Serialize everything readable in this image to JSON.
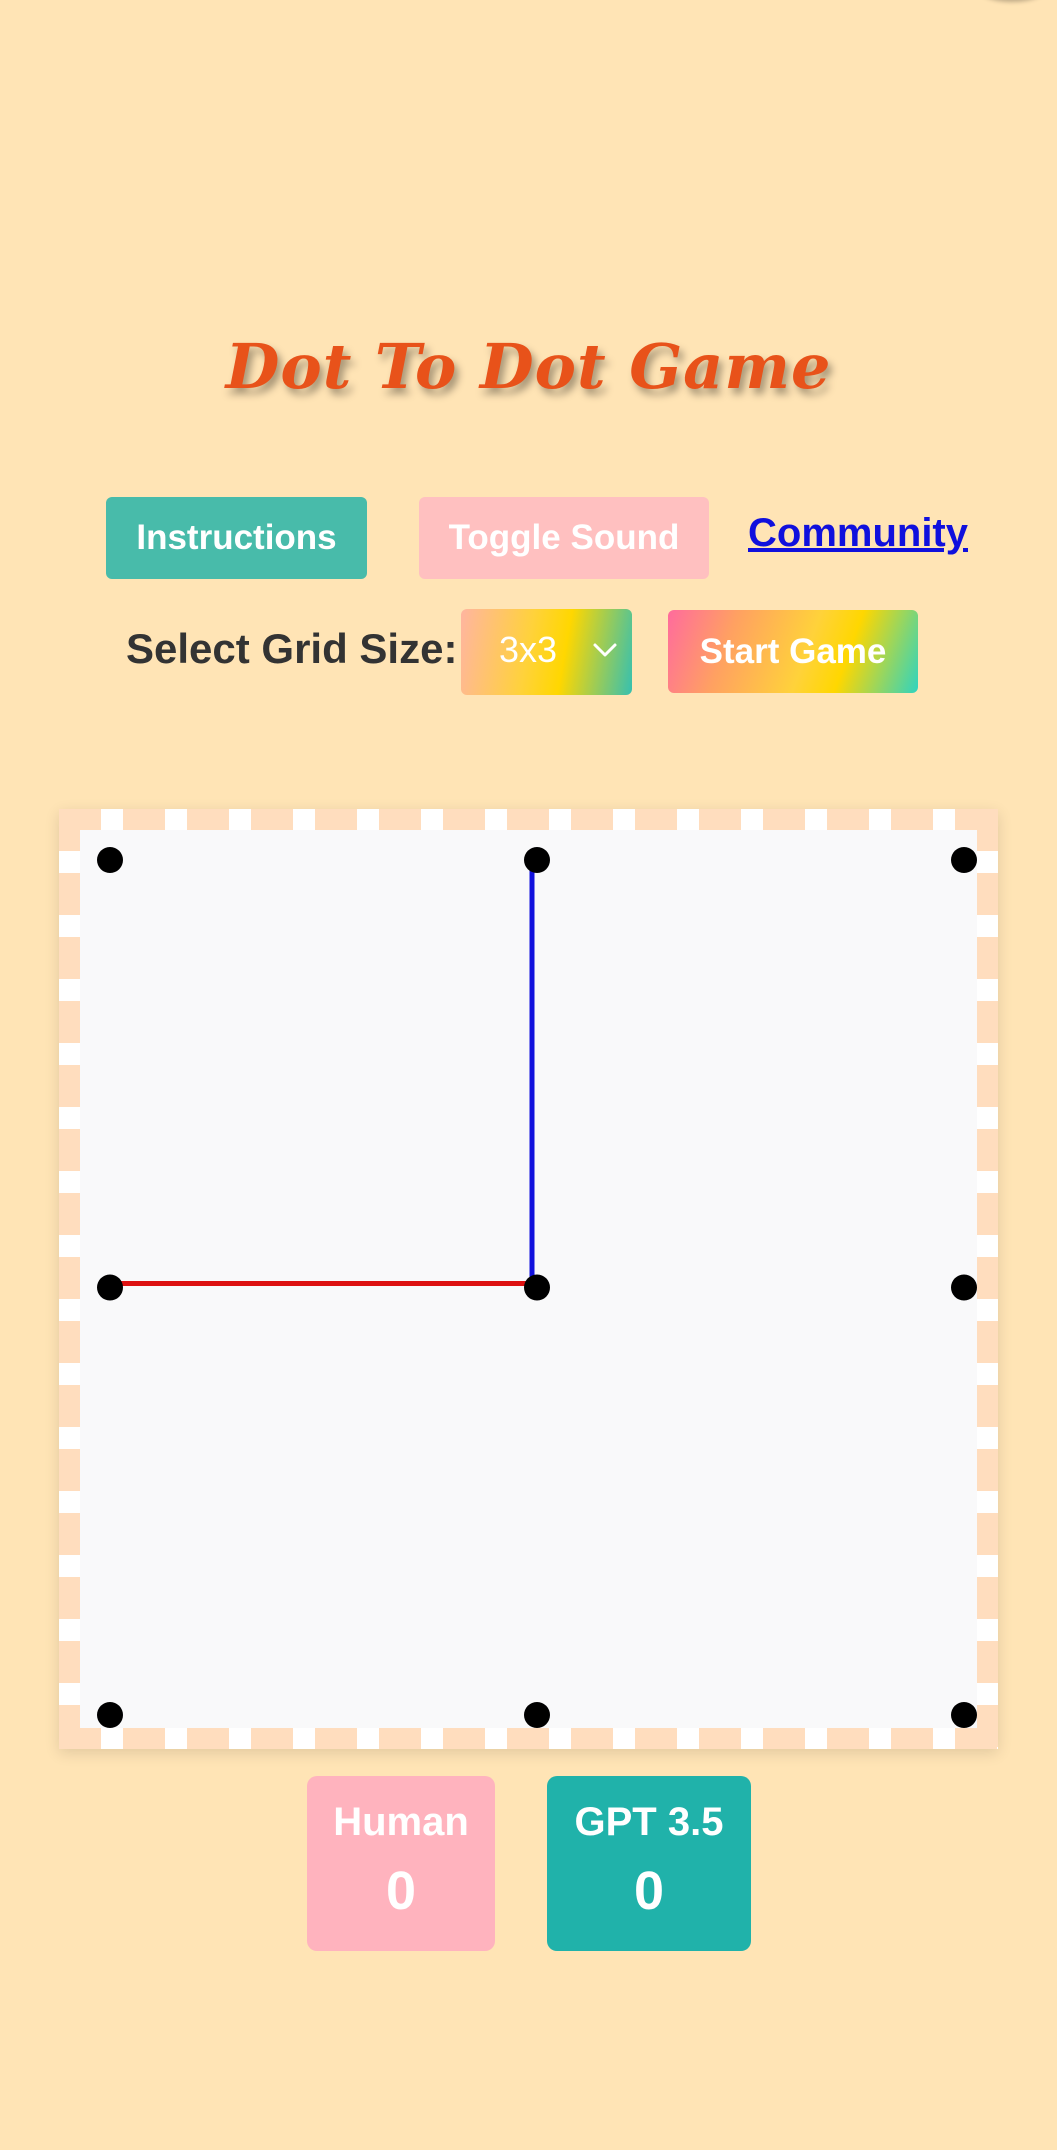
{
  "page": {
    "background": "#FFE4B5",
    "title": "Dot To Dot Game",
    "title_color": "#E8521A"
  },
  "toolbar": {
    "instructions_label": "Instructions",
    "sound_label": "Toggle Sound",
    "community_label": "Community",
    "grid_size_label": "Select Grid Size:",
    "grid_size_value": "3x3",
    "start_label": "Start Game"
  },
  "colors": {
    "instructions_button": "#48BBAA",
    "sound_button": "#FFC0C0",
    "community_link": "#1010DD",
    "human_line": "#DD1111",
    "gpt_line": "#1111DD",
    "dot": "#000000",
    "human_score_card": "#FFB3BE",
    "gpt_score_card": "#20B2AA"
  },
  "board": {
    "grid_rows": 3,
    "grid_cols": 3,
    "drawn_lines": [
      {
        "from": [
          1,
          0
        ],
        "to": [
          1,
          1
        ],
        "player": "gpt"
      },
      {
        "from": [
          0,
          1
        ],
        "to": [
          1,
          1
        ],
        "player": "human"
      }
    ]
  },
  "scores": {
    "human_label": "Human",
    "human_value": "0",
    "gpt_label": "GPT 3.5",
    "gpt_value": "0"
  },
  "icons": {
    "dropdown": "chevron-down-icon"
  }
}
